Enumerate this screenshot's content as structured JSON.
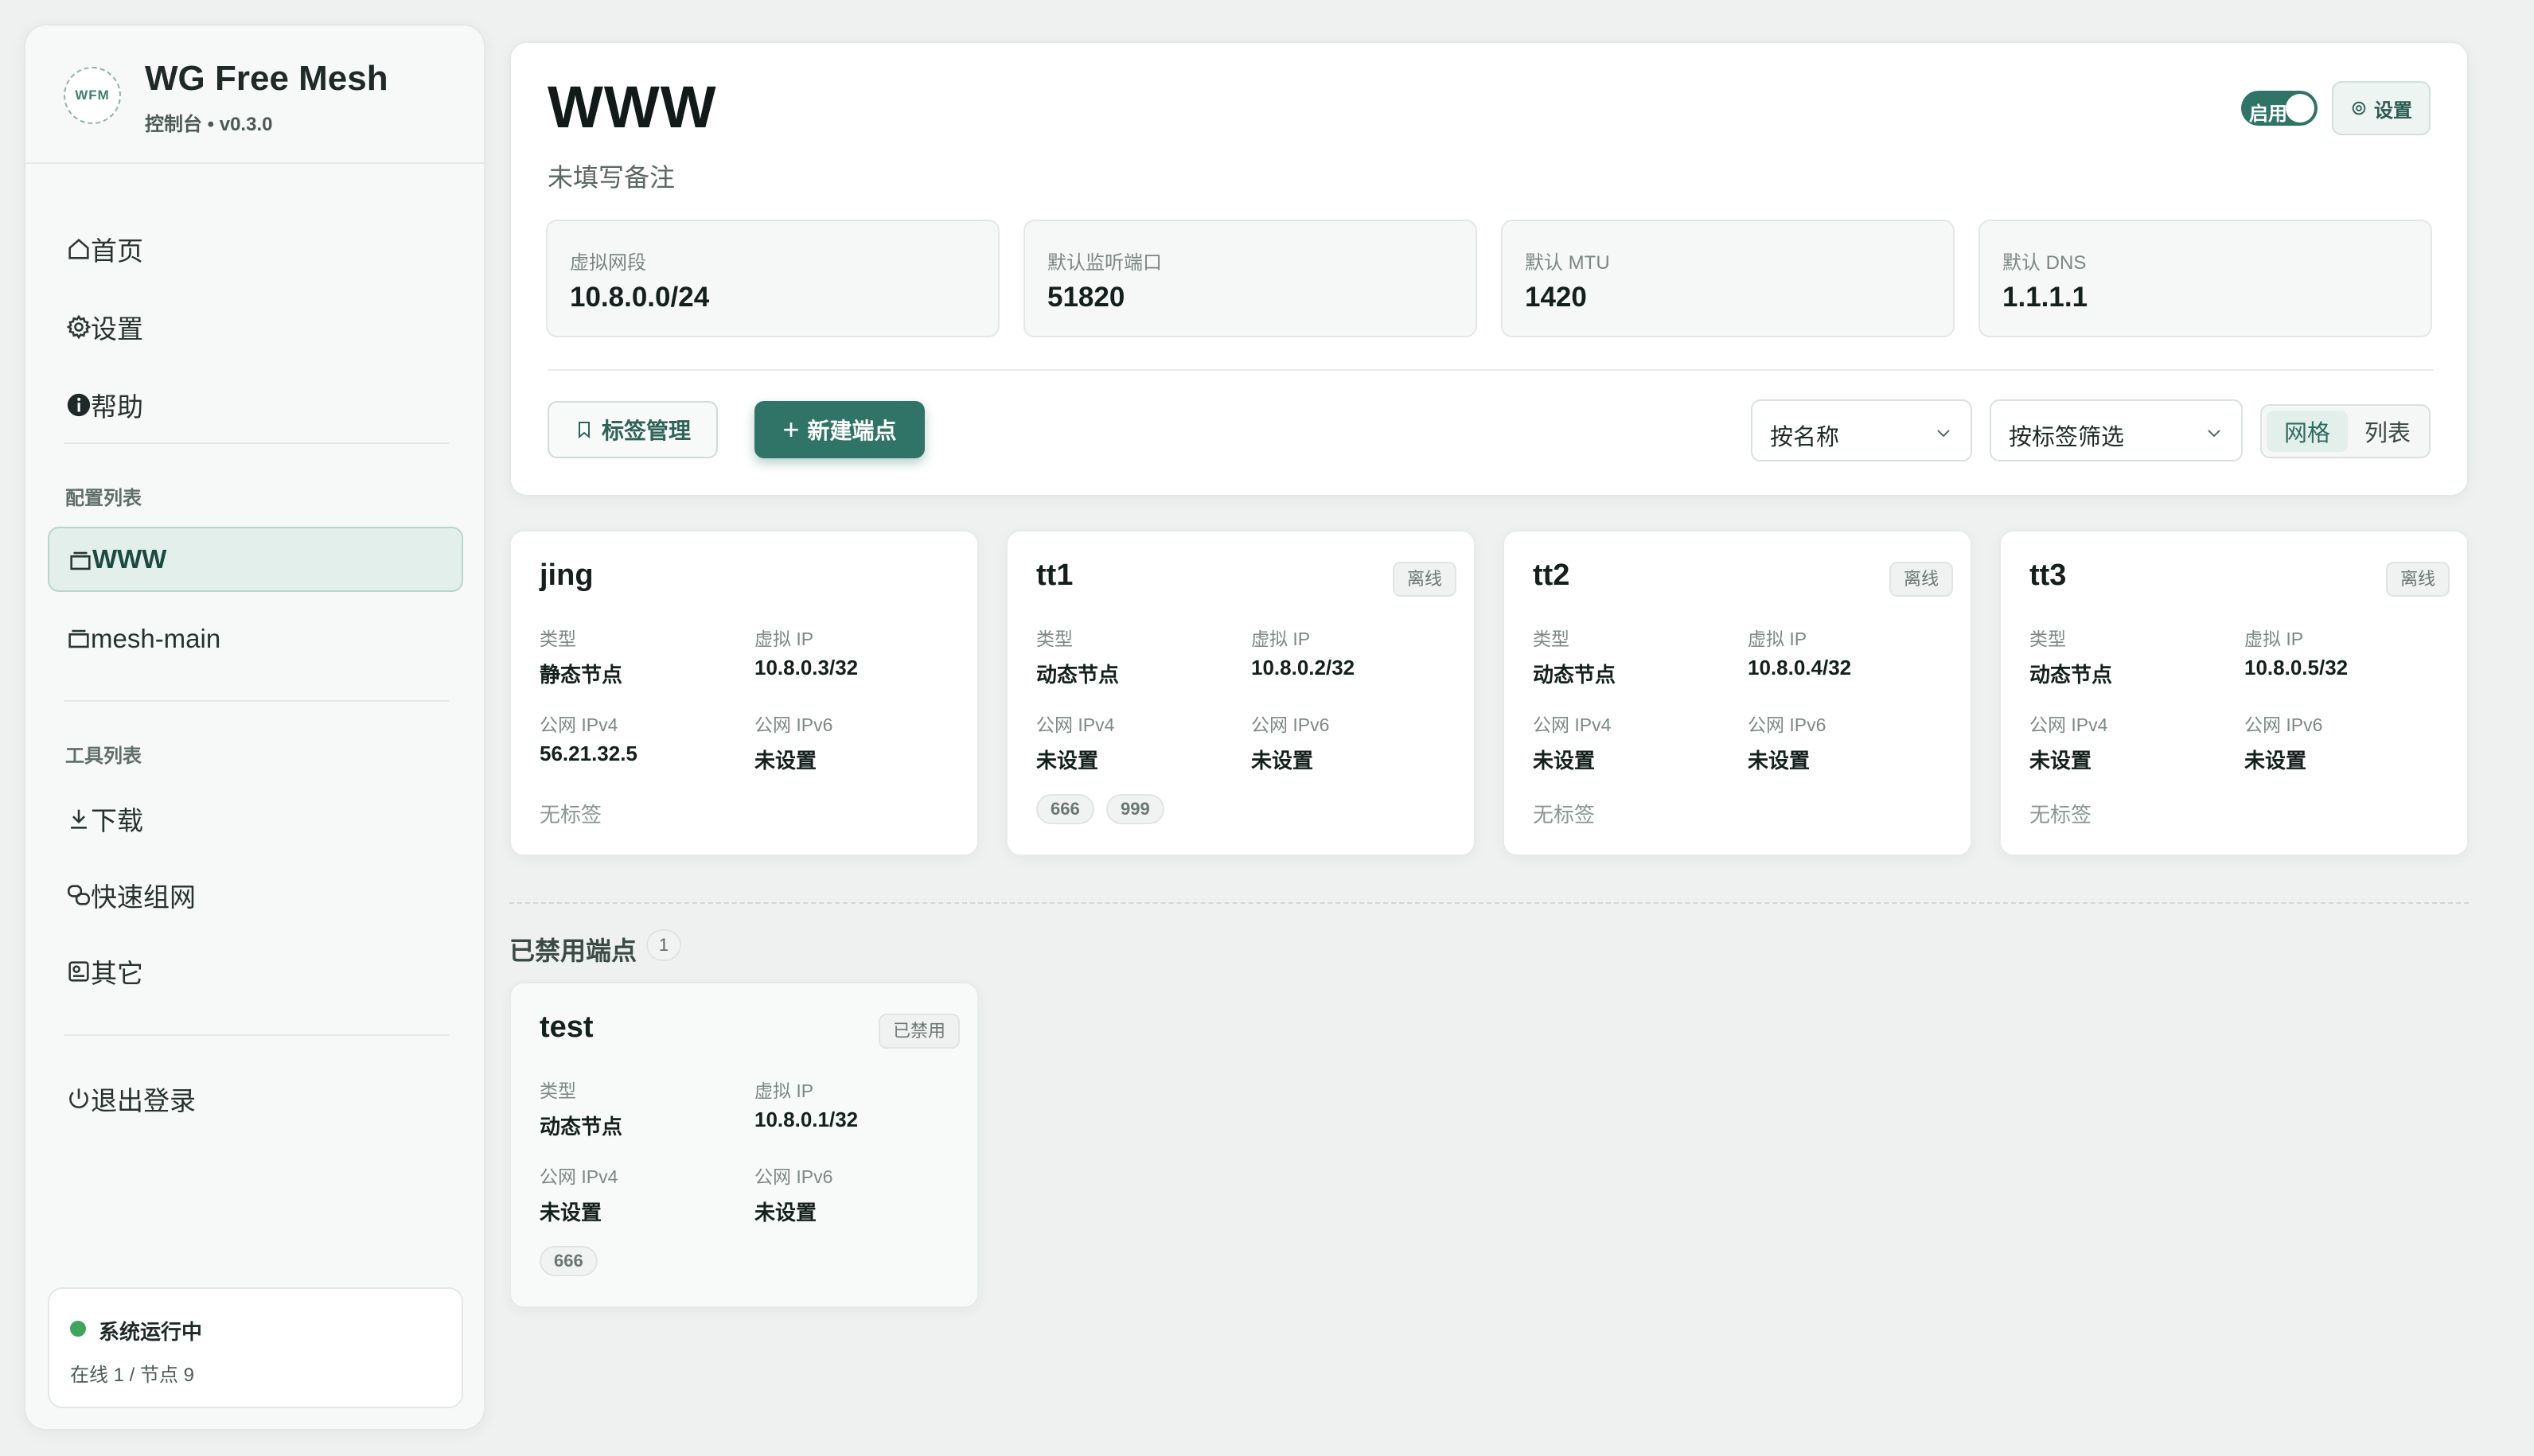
{
  "brand": {
    "logo_text": "WFM",
    "title": "WG Free Mesh",
    "subtitle": "控制台 • v0.3.0"
  },
  "nav": {
    "main": [
      {
        "label": "首页",
        "icon": "home-icon"
      },
      {
        "label": "设置",
        "icon": "gear-icon"
      },
      {
        "label": "帮助",
        "icon": "info-icon"
      }
    ],
    "config_section_title": "配置列表",
    "configs": [
      {
        "label": "WWW",
        "icon": "folder-icon",
        "active": true
      },
      {
        "label": "mesh-main",
        "icon": "folder-icon",
        "active": false
      }
    ],
    "tools_section_title": "工具列表",
    "tools": [
      {
        "label": "下载",
        "icon": "download-icon"
      },
      {
        "label": "快速组网",
        "icon": "link-icon"
      },
      {
        "label": "其它",
        "icon": "toolbox-icon"
      }
    ],
    "logout": {
      "label": "退出登录",
      "icon": "power-icon"
    }
  },
  "status": {
    "text": "系统运行中",
    "sub": "在线 1 / 节点 9",
    "color": "#3ea55a"
  },
  "network": {
    "name": "WWW",
    "note": "未填写备注",
    "enabled_label": "启用",
    "enabled": true,
    "settings_label": "设置",
    "stats": [
      {
        "label": "虚拟网段",
        "value": "10.8.0.0/24"
      },
      {
        "label": "默认监听端口",
        "value": "51820"
      },
      {
        "label": "默认 MTU",
        "value": "1420"
      },
      {
        "label": "默认 DNS",
        "value": "1.1.1.1"
      }
    ]
  },
  "toolbar": {
    "tags_button": "标签管理",
    "new_button": "新建端点",
    "sort_select": "按名称",
    "filter_select": "按标签筛选",
    "view_grid": "网格",
    "view_list": "列表"
  },
  "labels": {
    "type": "类型",
    "virtual_ip": "虚拟 IP",
    "public_ipv4": "公网 IPv4",
    "public_ipv6": "公网 IPv6",
    "no_tags": "无标签"
  },
  "peers": [
    {
      "name": "jing",
      "badge": "",
      "type": "静态节点",
      "virtual_ip": "10.8.0.3/32",
      "ipv4": "56.21.32.5",
      "ipv6": "未设置",
      "tags": []
    },
    {
      "name": "tt1",
      "badge": "离线",
      "type": "动态节点",
      "virtual_ip": "10.8.0.2/32",
      "ipv4": "未设置",
      "ipv6": "未设置",
      "tags": [
        "666",
        "999"
      ]
    },
    {
      "name": "tt2",
      "badge": "离线",
      "type": "动态节点",
      "virtual_ip": "10.8.0.4/32",
      "ipv4": "未设置",
      "ipv6": "未设置",
      "tags": []
    },
    {
      "name": "tt3",
      "badge": "离线",
      "type": "动态节点",
      "virtual_ip": "10.8.0.5/32",
      "ipv4": "未设置",
      "ipv6": "未设置",
      "tags": []
    }
  ],
  "disabled_section": {
    "title": "已禁用端点",
    "count": "1",
    "peers": [
      {
        "name": "test",
        "badge": "已禁用",
        "type": "动态节点",
        "virtual_ip": "10.8.0.1/32",
        "ipv4": "未设置",
        "ipv6": "未设置",
        "tags": [
          "666"
        ]
      }
    ]
  },
  "colors": {
    "accent": "#2f7466",
    "background": "#eef1f0",
    "online": "#3ea55a"
  }
}
